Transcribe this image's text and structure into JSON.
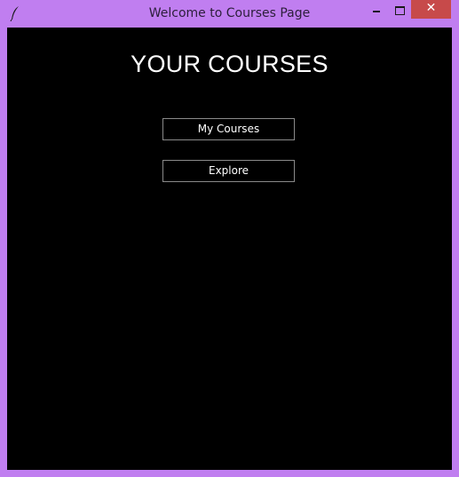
{
  "window": {
    "title": "Welcome to Courses Page",
    "icon": "feather-icon",
    "controls": {
      "minimize_icon": "minimize-icon",
      "maximize_icon": "maximize-icon",
      "close_glyph": "✕"
    },
    "colors": {
      "frame": "#c07ef0",
      "close": "#c74a4a",
      "background": "#000000",
      "text": "#ffffff"
    }
  },
  "main": {
    "heading": "YOUR COURSES",
    "buttons": {
      "my_courses": "My Courses",
      "explore": "Explore"
    }
  }
}
